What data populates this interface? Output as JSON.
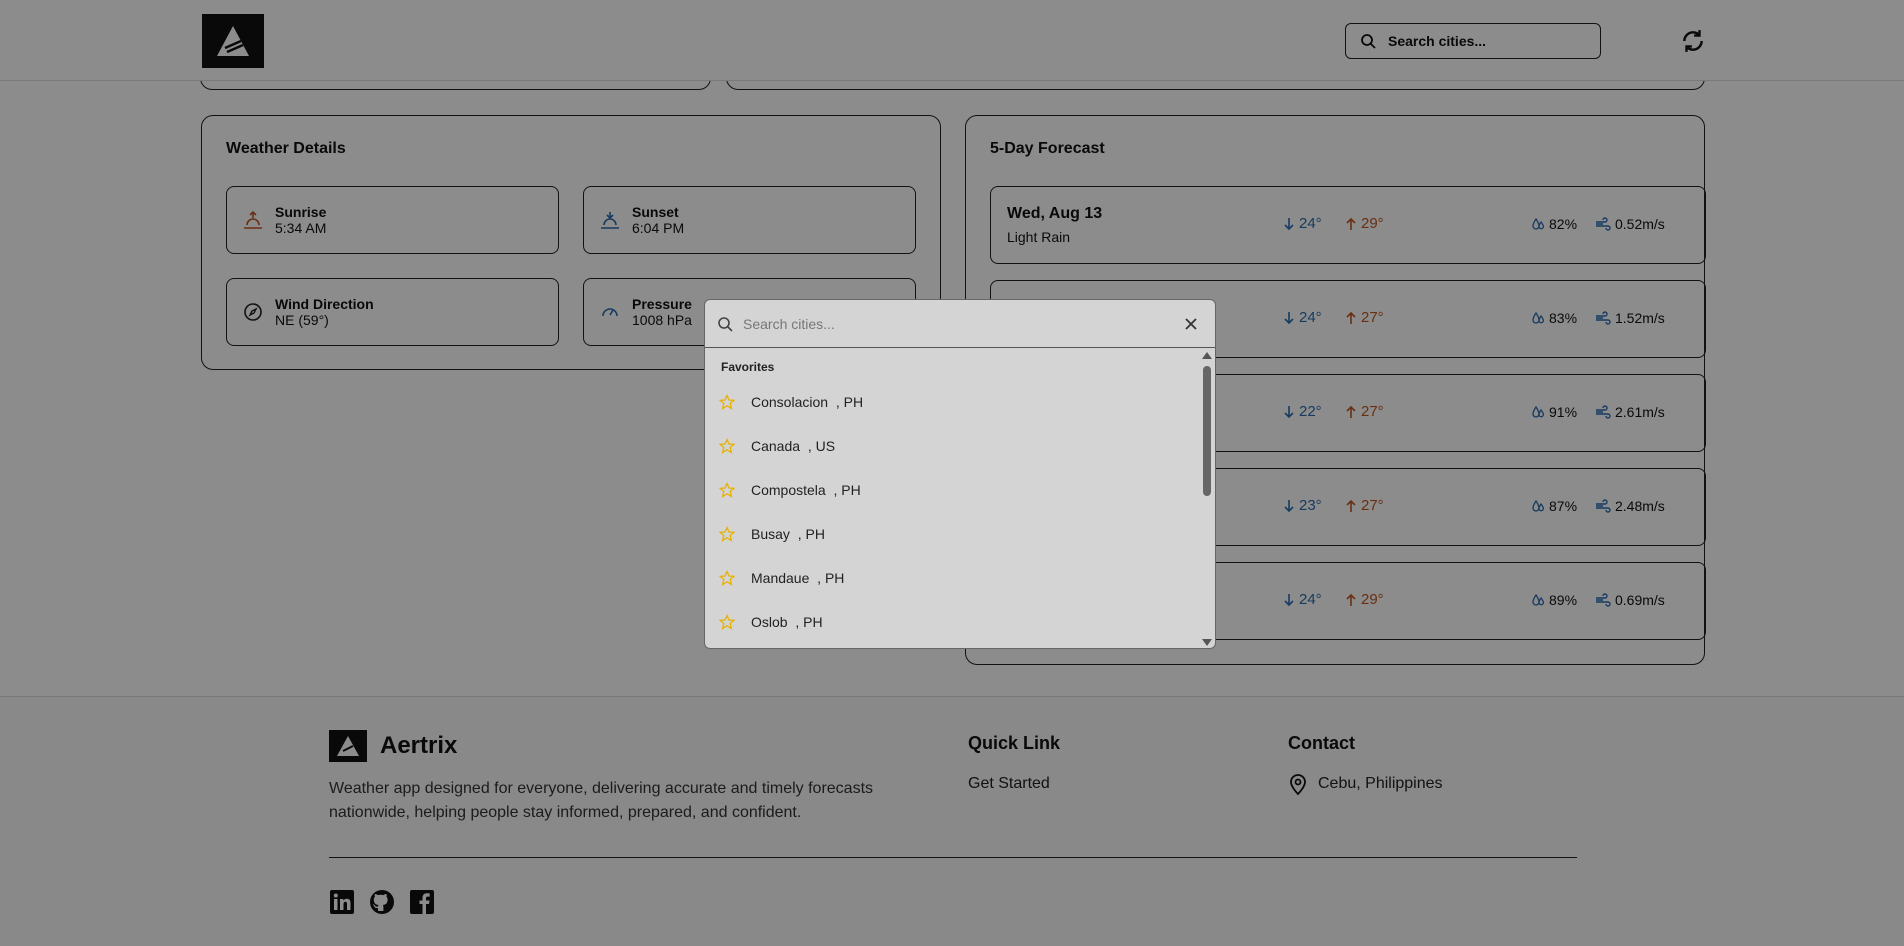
{
  "header": {
    "search_placeholder": "Search cities..."
  },
  "weather_details": {
    "title": "Weather Details",
    "sunrise_label": "Sunrise",
    "sunrise_value": "5:34 AM",
    "sunset_label": "Sunset",
    "sunset_value": "6:04 PM",
    "wind_label": "Wind Direction",
    "wind_value": "NE (59°)",
    "pressure_label": "Pressure",
    "pressure_value": "1008 hPa"
  },
  "forecast": {
    "title": "5-Day Forecast",
    "days": [
      {
        "day": "Wed, Aug 13",
        "condition": "Light Rain",
        "low": "24°",
        "high": "29°",
        "humidity": "82%",
        "wind": "0.52m/s"
      },
      {
        "day": "",
        "condition": "",
        "low": "24°",
        "high": "27°",
        "humidity": "83%",
        "wind": "1.52m/s"
      },
      {
        "day": "",
        "condition": "",
        "low": "22°",
        "high": "27°",
        "humidity": "91%",
        "wind": "2.61m/s"
      },
      {
        "day": "",
        "condition": "",
        "low": "23°",
        "high": "27°",
        "humidity": "87%",
        "wind": "2.48m/s"
      },
      {
        "day": "",
        "condition": "",
        "low": "24°",
        "high": "29°",
        "humidity": "89%",
        "wind": "0.69m/s"
      }
    ]
  },
  "modal": {
    "search_placeholder": "Search cities...",
    "favorites_label": "Favorites",
    "favorites": [
      {
        "city": "Consolacion",
        "country": ", PH"
      },
      {
        "city": "Canada",
        "country": ", US"
      },
      {
        "city": "Compostela",
        "country": ", PH"
      },
      {
        "city": "Busay",
        "country": ", PH"
      },
      {
        "city": "Mandaue",
        "country": ", PH"
      },
      {
        "city": "Oslob",
        "country": ", PH"
      }
    ]
  },
  "footer": {
    "brand": "Aertrix",
    "description": "Weather app designed for everyone, delivering accurate and timely forecasts nationwide, helping people stay informed, prepared, and confident.",
    "quick_link_title": "Quick Link",
    "quick_link_item": "Get Started",
    "contact_title": "Contact",
    "contact_location": "Cebu, Philippines"
  },
  "colors": {
    "star": "#e8b100",
    "temp_low": "#2b6cb0",
    "temp_high": "#c05621"
  },
  "icons": [
    "logo-icon",
    "search-icon",
    "refresh-icon",
    "sunrise-icon",
    "sunset-icon",
    "compass-icon",
    "gauge-icon",
    "arrow-down-icon",
    "arrow-up-icon",
    "humidity-icon",
    "wind-icon",
    "star-icon",
    "close-icon",
    "map-pin-icon",
    "linkedin-icon",
    "github-icon",
    "facebook-icon"
  ]
}
